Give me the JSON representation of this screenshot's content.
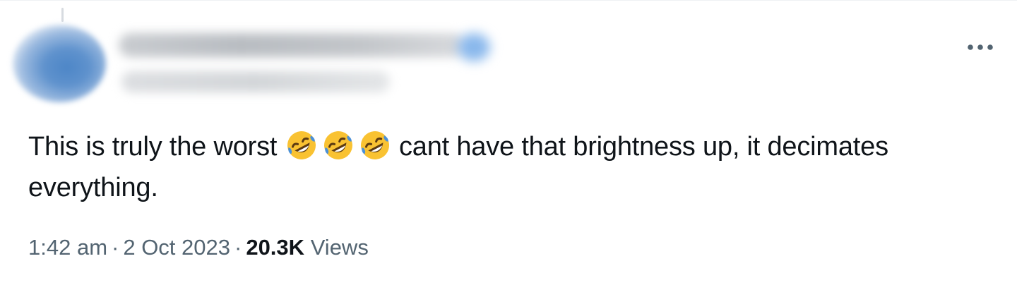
{
  "tweet": {
    "text_before": "This is truly the worst ",
    "text_after": " cant have that brightness up, it decimates everything.",
    "emojis": [
      "rolling-on-floor-laughing-emoji",
      "rolling-on-floor-laughing-emoji",
      "rolling-on-floor-laughing-emoji"
    ]
  },
  "meta": {
    "time": "1:42 am",
    "separator": "·",
    "date": "2 Oct 2023",
    "views_count": "20.3K",
    "views_label": "Views"
  },
  "icons": {
    "more": "more-horizontal-icon"
  },
  "colors": {
    "text": "#0f1419",
    "secondary_text": "#536471",
    "emoji_face": "#f9c232",
    "emoji_tear": "#4a90d9"
  }
}
